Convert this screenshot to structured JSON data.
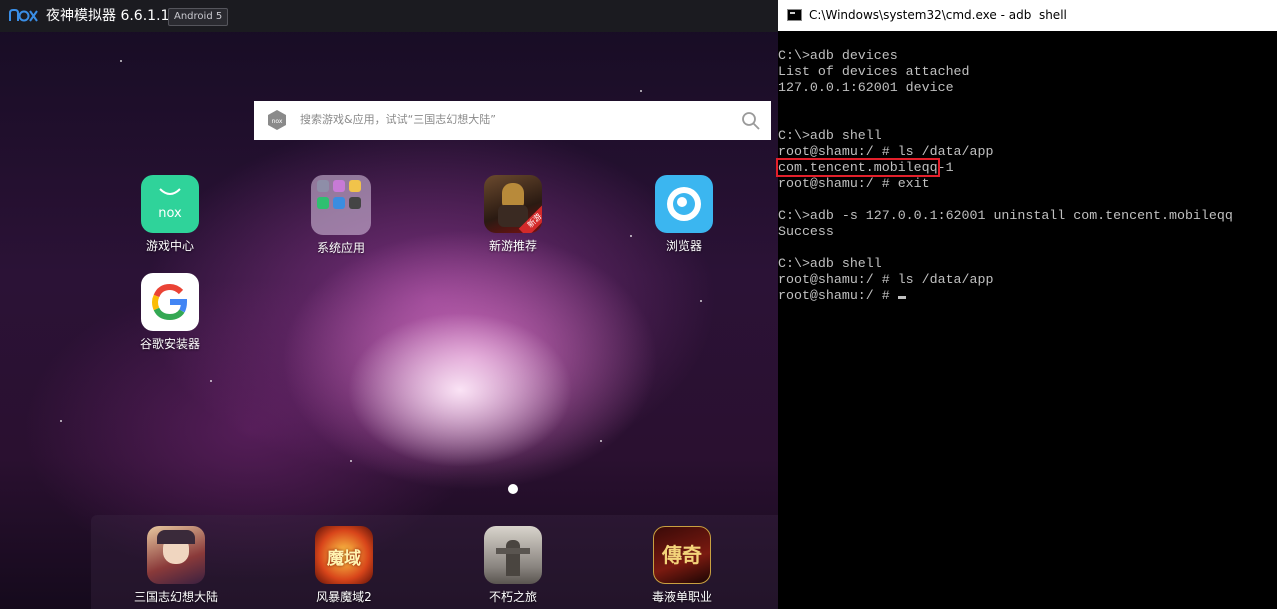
{
  "emulator": {
    "title": "夜神模拟器 6.6.1.1",
    "badge": "Android 5",
    "search_placeholder": "搜索游戏&应用，试试“三国志幻想大陆”",
    "apps": [
      {
        "label": "游戏中心",
        "icon": "nox-game-center-icon"
      },
      {
        "label": "系统应用",
        "icon": "system-apps-folder-icon"
      },
      {
        "label": "新游推荐",
        "icon": "new-games-icon",
        "ribbon": "新游"
      },
      {
        "label": "浏览器",
        "icon": "browser-icon"
      },
      {
        "label": "谷歌安装器",
        "icon": "google-installer-icon"
      }
    ],
    "dock_apps": [
      {
        "label": "三国志幻想大陆",
        "icon": "sanguozhi-game-icon"
      },
      {
        "label": "风暴魔域2",
        "icon": "fengbao-moyu-game-icon",
        "art_text": "魔域"
      },
      {
        "label": "不朽之旅",
        "icon": "buxiu-game-icon"
      },
      {
        "label": "毒液单职业",
        "icon": "duye-game-icon",
        "art_text": "傳奇"
      }
    ]
  },
  "cmd": {
    "title": "C:\\Windows\\system32\\cmd.exe - adb  shell",
    "lines": [
      "C:\\>adb devices",
      "List of devices attached",
      "127.0.0.1:62001 device",
      "",
      "",
      "C:\\>adb shell",
      "root@shamu:/ # ls /data/app",
      "",
      "root@shamu:/ # exit",
      "",
      "C:\\>adb -s 127.0.0.1:62001 uninstall com.tencent.mobileqq",
      "Success",
      "",
      "C:\\>adb shell",
      "root@shamu:/ # ls /data/app",
      "root@shamu:/ # "
    ],
    "highlight_line": {
      "highlighted": "com.tencent.mobileqq",
      "rest": "-1"
    },
    "highlight_color": "#e3202b"
  }
}
